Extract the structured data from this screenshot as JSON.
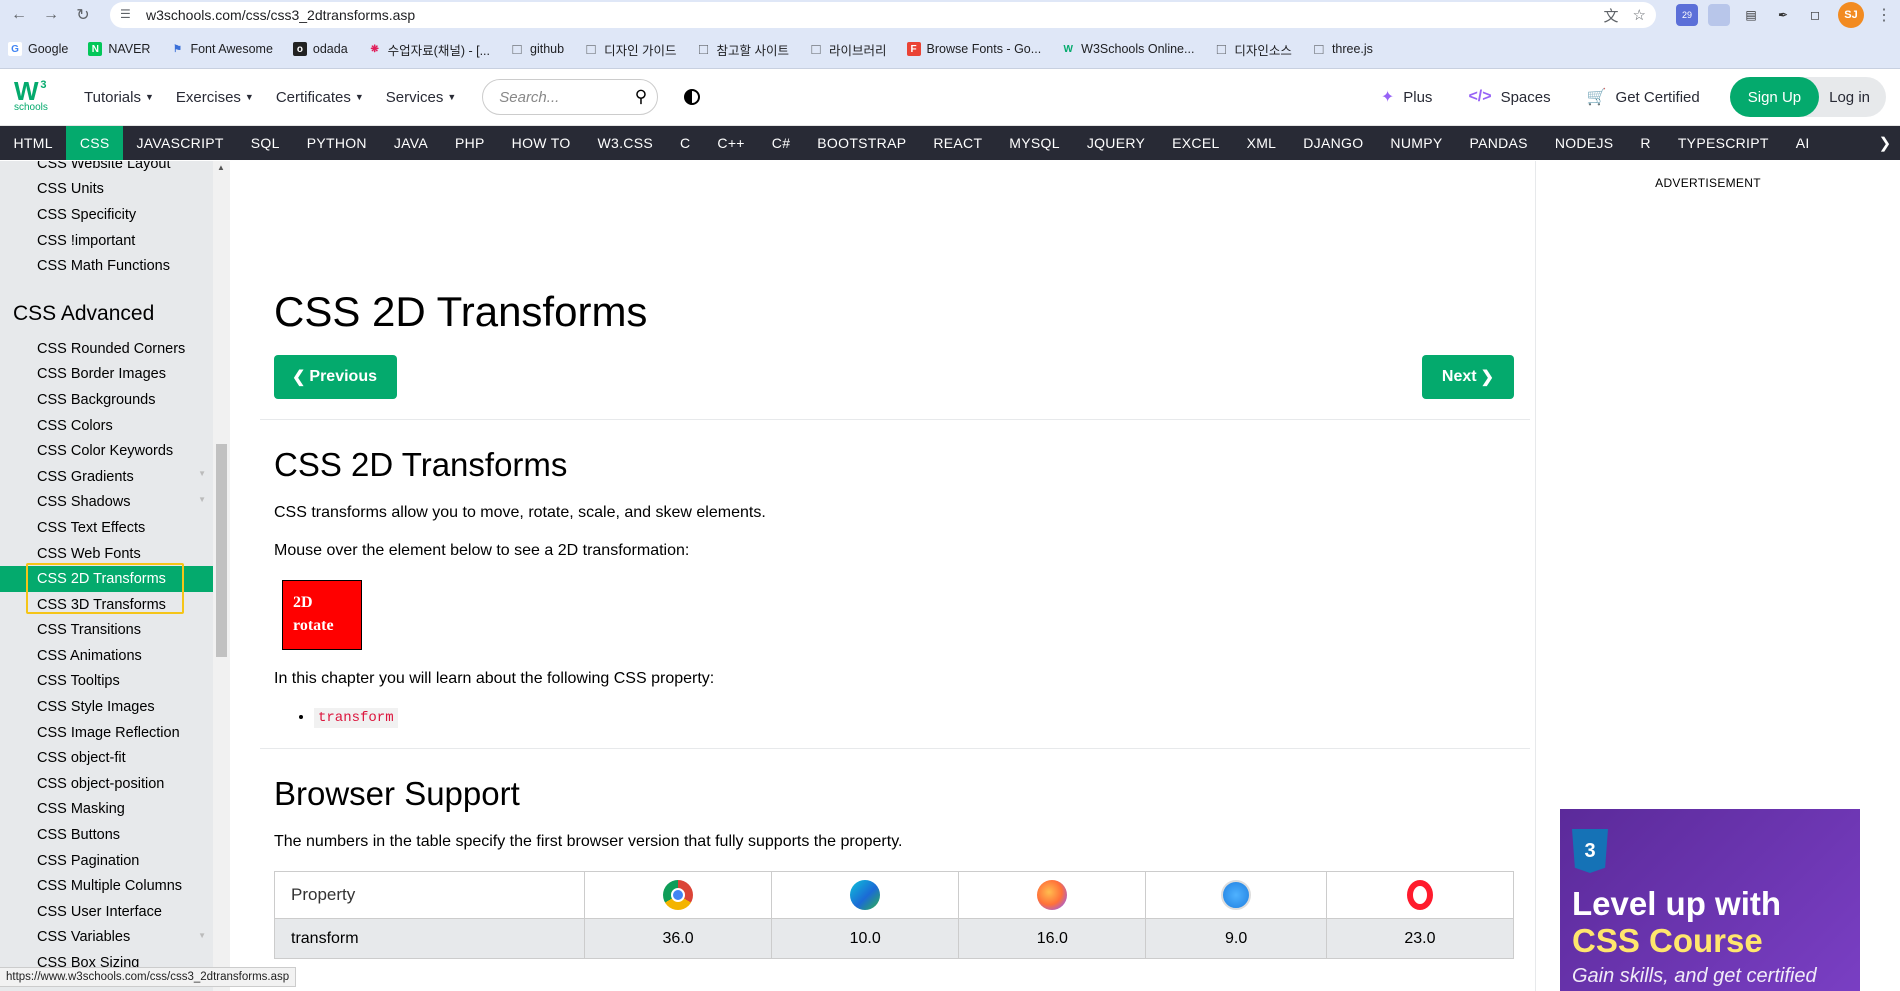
{
  "browser": {
    "url": "w3schools.com/css/css3_2dtransforms.asp",
    "ext_badge": "29",
    "avatar_initials": "SJ",
    "bookmarks": [
      {
        "label": "Google",
        "icon": "google-icon"
      },
      {
        "label": "NAVER",
        "icon": "naver-icon"
      },
      {
        "label": "Font Awesome",
        "icon": "flag-icon"
      },
      {
        "label": "odada",
        "icon": "odada-icon"
      },
      {
        "label": "수업자료(채널) - [...",
        "icon": "slack-icon"
      },
      {
        "label": "github",
        "icon": "folder-icon"
      },
      {
        "label": "디자인 가이드",
        "icon": "folder-icon"
      },
      {
        "label": "참고할 사이트",
        "icon": "folder-icon"
      },
      {
        "label": "라이브러리",
        "icon": "folder-icon"
      },
      {
        "label": "Browse Fonts - Go...",
        "icon": "google-fonts-icon"
      },
      {
        "label": "W3Schools Online...",
        "icon": "w3-icon"
      },
      {
        "label": "디자인소스",
        "icon": "folder-icon"
      },
      {
        "label": "three.js",
        "icon": "folder-icon"
      }
    ]
  },
  "topnav": {
    "logo_main": "W",
    "logo_sup": "3",
    "logo_sub": "schools",
    "menus": [
      "Tutorials",
      "Exercises",
      "Certificates",
      "Services"
    ],
    "search_placeholder": "Search...",
    "plus": "Plus",
    "spaces": "Spaces",
    "get_certified": "Get Certified",
    "signup": "Sign Up",
    "login": "Log in"
  },
  "topics": [
    "HTML",
    "CSS",
    "JAVASCRIPT",
    "SQL",
    "PYTHON",
    "JAVA",
    "PHP",
    "HOW TO",
    "W3.CSS",
    "C",
    "C++",
    "C#",
    "BOOTSTRAP",
    "REACT",
    "MYSQL",
    "JQUERY",
    "EXCEL",
    "XML",
    "DJANGO",
    "NUMPY",
    "PANDAS",
    "NODEJS",
    "R",
    "TYPESCRIPT",
    "AI"
  ],
  "active_topic": "CSS",
  "sidebar": {
    "items_top": [
      "CSS Website Layout",
      "CSS Units",
      "CSS Specificity",
      "CSS !important",
      "CSS Math Functions"
    ],
    "heading": "CSS Advanced",
    "items": [
      "CSS Rounded Corners",
      "CSS Border Images",
      "CSS Backgrounds",
      "CSS Colors",
      "CSS Color Keywords",
      "CSS Gradients",
      "CSS Shadows",
      "CSS Text Effects",
      "CSS Web Fonts",
      "CSS 2D Transforms",
      "CSS 3D Transforms",
      "CSS Transitions",
      "CSS Animations",
      "CSS Tooltips",
      "CSS Style Images",
      "CSS Image Reflection",
      "CSS object-fit",
      "CSS object-position",
      "CSS Masking",
      "CSS Buttons",
      "CSS Pagination",
      "CSS Multiple Columns",
      "CSS User Interface",
      "CSS Variables",
      "CSS Box Sizing"
    ],
    "active": "CSS 2D Transforms"
  },
  "content": {
    "title": "CSS 2D Transforms",
    "prev": "Previous",
    "next": "Next",
    "section1_title": "CSS 2D Transforms",
    "p1": "CSS transforms allow you to move, rotate, scale, and skew elements.",
    "p2": "Mouse over the element below to see a 2D transformation:",
    "demo_line1": "2D",
    "demo_line2": "rotate",
    "p3": "In this chapter you will learn about the following CSS property:",
    "property": "transform",
    "section2_title": "Browser Support",
    "p4": "The numbers in the table specify the first browser version that fully supports the property.",
    "table": {
      "header": "Property",
      "browsers": [
        "chrome-icon",
        "edge-icon",
        "firefox-icon",
        "safari-icon",
        "opera-icon"
      ],
      "row_label": "transform",
      "values": [
        "36.0",
        "10.0",
        "16.0",
        "9.0",
        "23.0"
      ]
    }
  },
  "ad": {
    "label": "ADVERTISEMENT",
    "promo_line1": "Level up with",
    "promo_line2": "CSS Course",
    "promo_sub": "Gain skills, and get certified"
  },
  "status_url": "https://www.w3schools.com/css/css3_2dtransforms.asp"
}
